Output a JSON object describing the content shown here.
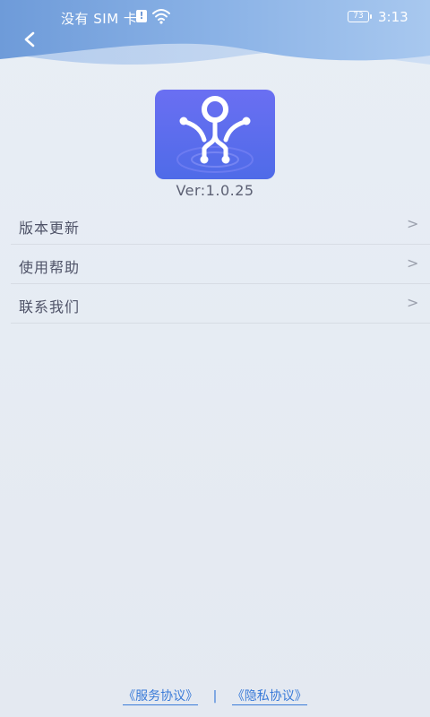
{
  "status_bar": {
    "carrier": "没有 SIM 卡",
    "sim_alert": "!",
    "battery": "73",
    "time": "3:13"
  },
  "header": {
    "back_icon": "chevron-left-icon",
    "accent_color": "#6c96d6"
  },
  "app": {
    "logo_icon": "circuit-logo-icon",
    "logo_color": "#5b6ef0",
    "version": "Ver:1.0.25"
  },
  "menu": {
    "items": [
      {
        "label": "版本更新",
        "chevron": ">"
      },
      {
        "label": "使用帮助",
        "chevron": ">"
      },
      {
        "label": "联系我们",
        "chevron": ">"
      }
    ]
  },
  "footer": {
    "service_agreement": "《服务协议》",
    "separator": "|",
    "privacy_agreement": "《隐私协议》",
    "link_color": "#3a7bd8"
  }
}
